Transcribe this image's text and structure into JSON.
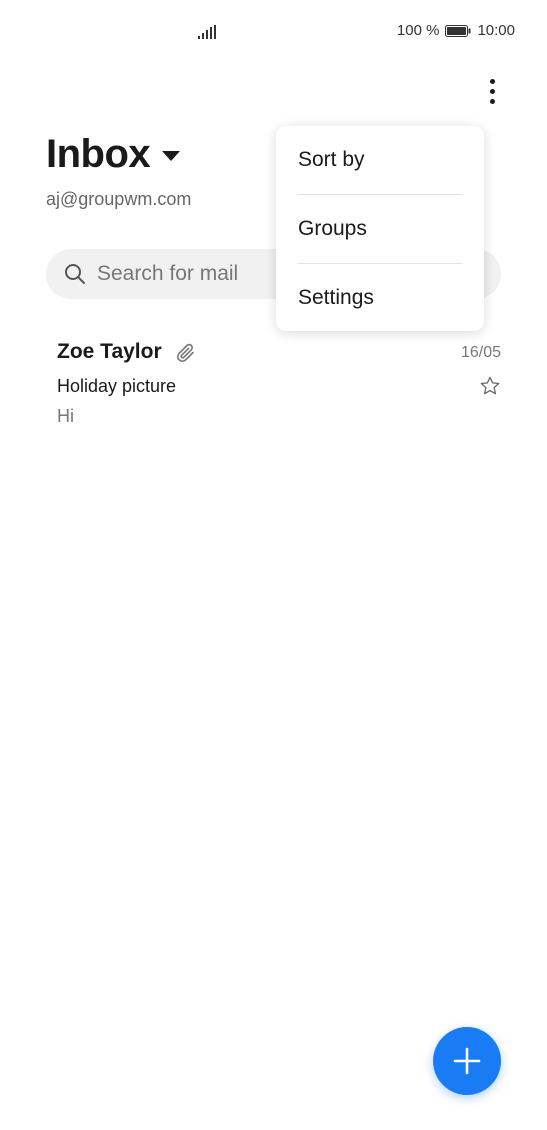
{
  "status_bar": {
    "battery_text": "100 %",
    "time": "10:00",
    "icons": [
      "signal-icon",
      "battery-icon"
    ]
  },
  "header": {
    "title": "Inbox",
    "account": "aj@groupwm.com",
    "icons": [
      "more-vertical-icon",
      "caret-down-icon"
    ]
  },
  "search": {
    "placeholder": "Search for mail",
    "icon": "search-icon"
  },
  "mail_list": [
    {
      "sender": "Zoe Taylor",
      "date": "16/05",
      "subject": "Holiday picture",
      "preview": "Hi",
      "has_attachment": true,
      "starred": false
    }
  ],
  "menu": {
    "items": [
      {
        "label": "Sort by"
      },
      {
        "label": "Groups"
      },
      {
        "label": "Settings"
      }
    ]
  },
  "fab": {
    "icon": "plus-icon",
    "color": "#1a7cf5"
  },
  "colors": {
    "accent": "#1a7cf5",
    "search_bg": "#f1f1f1",
    "secondary_text": "#777777"
  }
}
